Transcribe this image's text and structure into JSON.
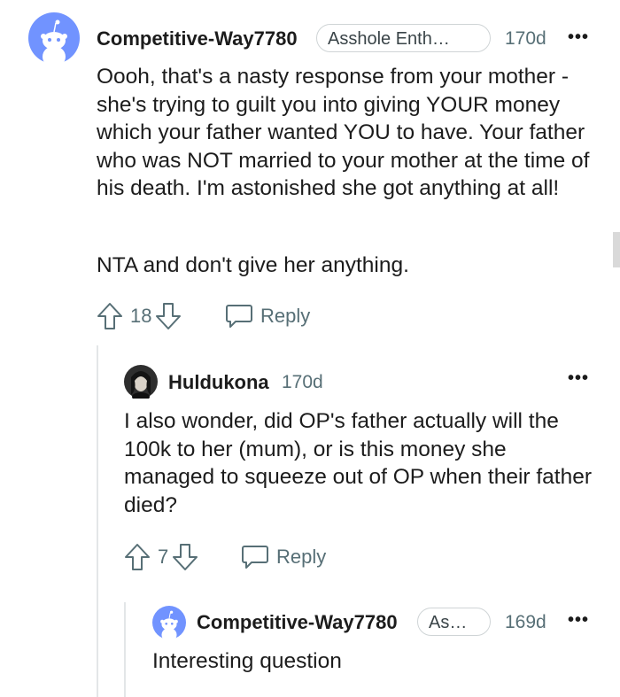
{
  "comments": [
    {
      "username": "Competitive-Way7780",
      "flair": "Asshole Enth…",
      "age": "170d",
      "paragraphs": [
        "Oooh, that's a nasty response from your mother - she's trying to guilt you into giving YOUR money which your father wanted YOU to have. Your father who was NOT married to your mother at the time of his death. I'm astonished she got anything at all!",
        "NTA and don't give her anything."
      ],
      "votes": "18",
      "reply_label": "Reply"
    },
    {
      "username": "Huldukona",
      "age": "170d",
      "paragraphs": [
        "I also wonder, did OP's father actually will the 100k to her (mum), or is this money she managed to squeeze out of OP when their father died?"
      ],
      "votes": "7",
      "reply_label": "Reply"
    },
    {
      "username": "Competitive-Way7780",
      "flair": "As…",
      "age": "169d",
      "paragraphs": [
        "Interesting question"
      ]
    }
  ],
  "more_label": "•••",
  "colors": {
    "text": "#1c1c1c",
    "meta": "#576f76",
    "avatar_bg": "#7193ff",
    "line": "#e3e6e8"
  }
}
